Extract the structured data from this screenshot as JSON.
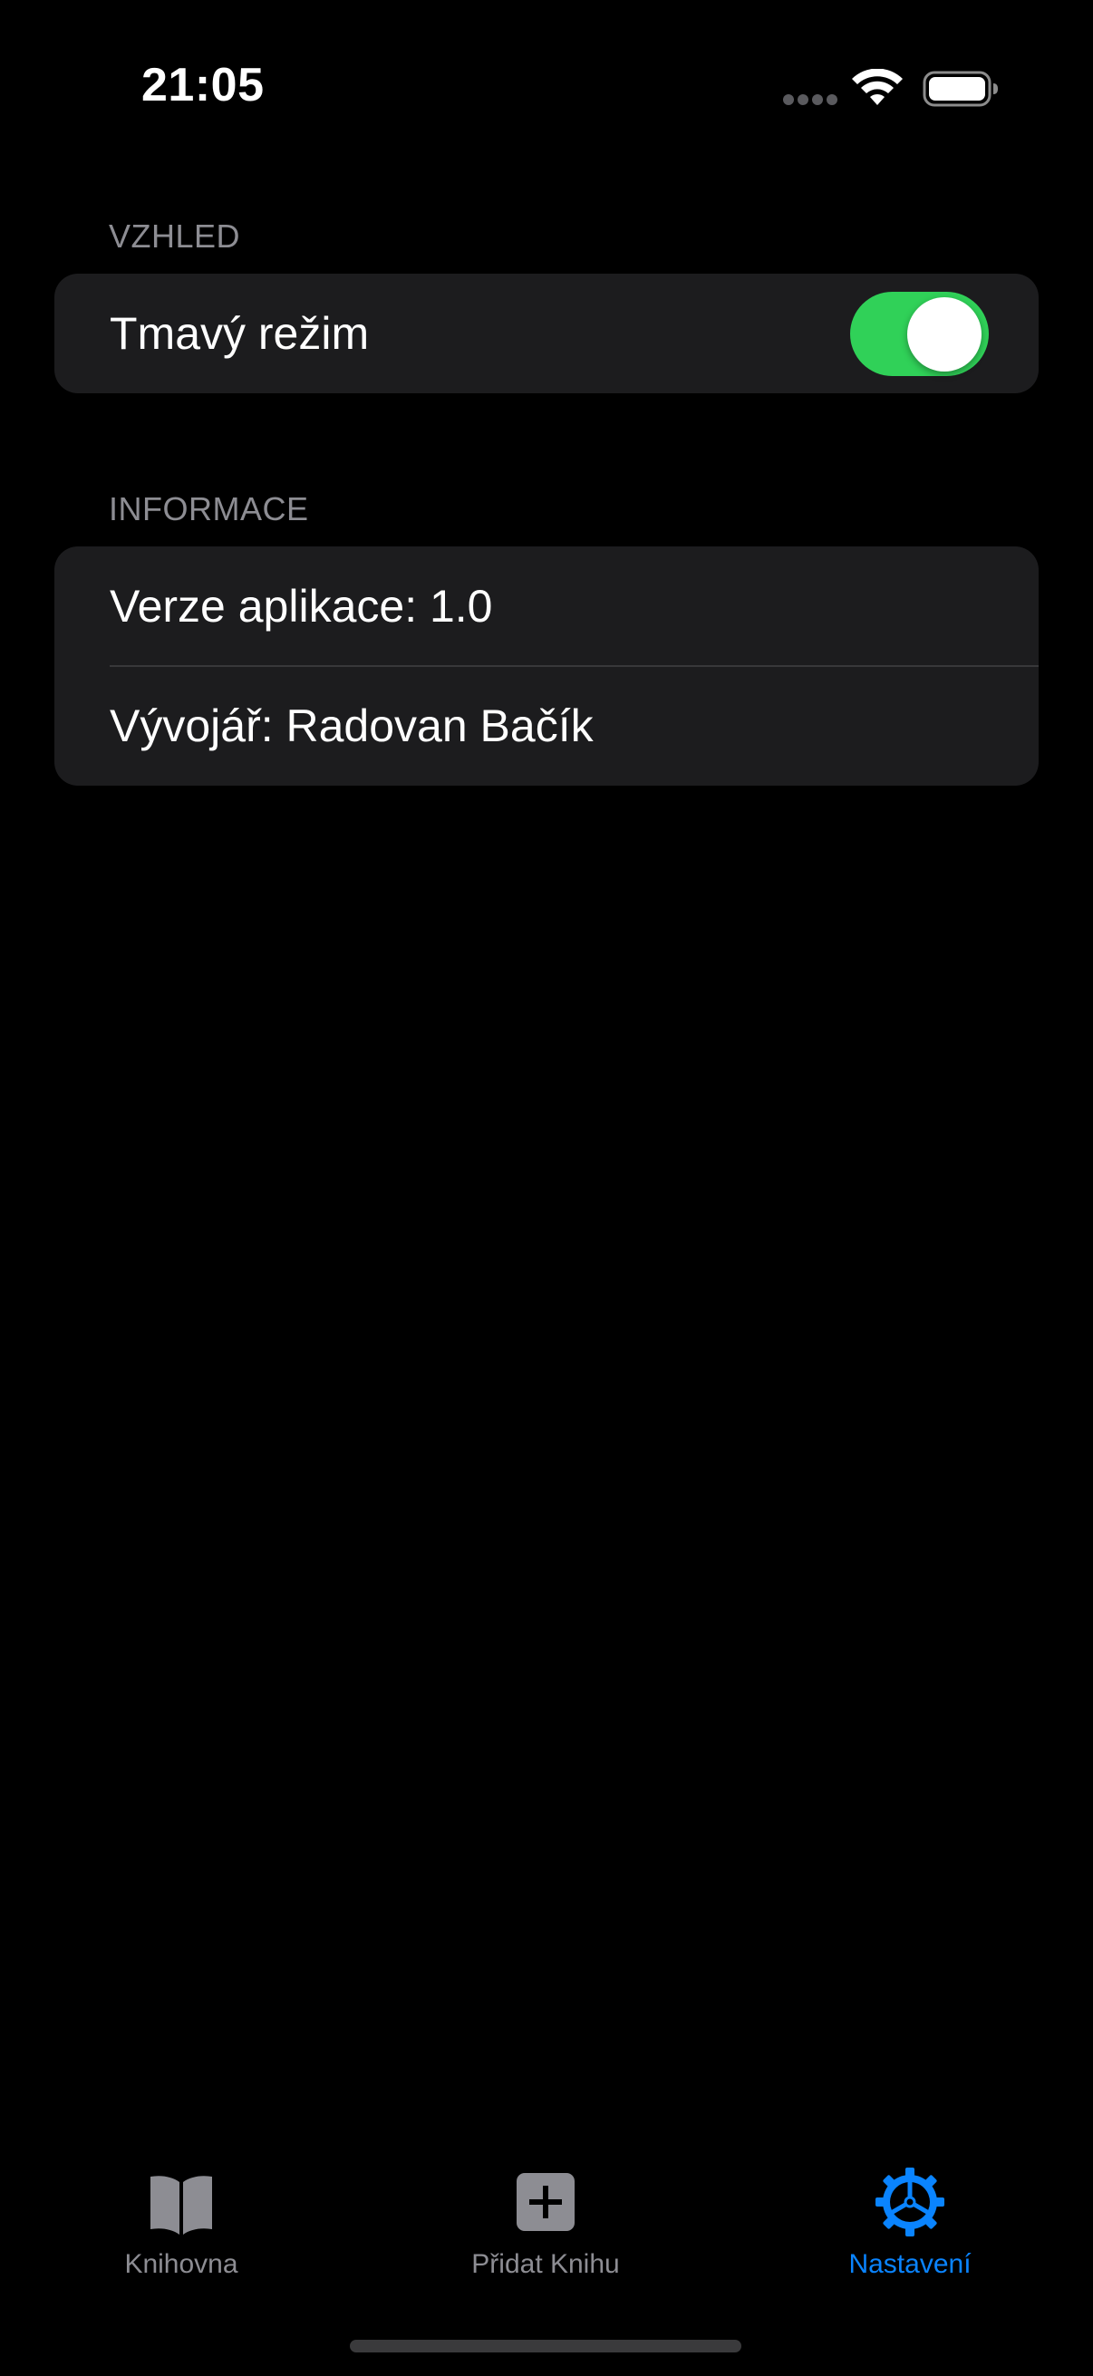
{
  "status_bar": {
    "time": "21:05",
    "signal_icon": "cellular-dots-icon",
    "wifi_icon": "wifi-icon",
    "battery_icon": "battery-full-icon"
  },
  "sections": {
    "appearance": {
      "header": "VZHLED",
      "dark_mode_label": "Tmavý režim",
      "dark_mode_on": true
    },
    "info": {
      "header": "INFORMACE",
      "version_label": "Verze aplikace: 1.0",
      "developer_label": "Vývojář: Radovan Bačík"
    }
  },
  "tab_bar": {
    "tabs": [
      {
        "label": "Knihovna",
        "icon": "book-icon",
        "active": false
      },
      {
        "label": "Přidat Knihu",
        "icon": "plus-square-icon",
        "active": false
      },
      {
        "label": "Nastavení",
        "icon": "gear-icon",
        "active": true
      }
    ]
  },
  "colors": {
    "background": "#000000",
    "group_background": "#1c1c1e",
    "toggle_on": "#30d158",
    "accent": "#0a84ff",
    "inactive_tab": "#8d8d93",
    "section_header": "#8d8d93"
  }
}
